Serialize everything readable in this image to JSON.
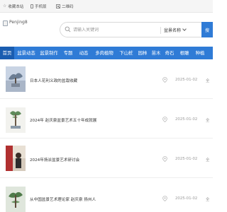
{
  "topbar": {
    "bookmark": "收藏本站",
    "mobile": "手机版",
    "qrcode": "二维码"
  },
  "header": {
    "logo_alt": "Penjing8"
  },
  "search": {
    "placeholder": "请输入关键词",
    "category": "盆景名称",
    "button_label": "搜"
  },
  "nav": {
    "items": [
      {
        "label": "首页",
        "active": true
      },
      {
        "label": "盆景动态"
      },
      {
        "label": "盆景制作"
      },
      {
        "label": "专题"
      },
      {
        "label": "动态"
      },
      {
        "label": "多肉植物"
      },
      {
        "label": "下山桩"
      },
      {
        "label": "园林"
      },
      {
        "label": "苗木"
      },
      {
        "label": "奇石"
      },
      {
        "label": "根雕"
      },
      {
        "label": "种植"
      }
    ]
  },
  "list": {
    "items": [
      {
        "title": "日本人花利义政的盆栽收藏",
        "date": "2025-01-02",
        "more": "全"
      },
      {
        "title": "2024年 赵庆泉盆景艺术五十年成就展",
        "date": "2025-01-02",
        "more": "全"
      },
      {
        "title": "2024年扬派盆景艺术研讨会",
        "date": "2025-01-02",
        "more": "全"
      },
      {
        "title": "从中国盆景艺术理论家 赵庆泉 扬州人",
        "date": "2025-01-02",
        "more": "全"
      }
    ]
  },
  "colors": {
    "accent": "#2f7bd6",
    "nav_active": "#1a5db0",
    "date_text": "#999999"
  },
  "icons": {
    "bookmark": "star-icon",
    "mobile": "phone-icon",
    "qrcode": "qrcode-icon",
    "search": "search-icon",
    "row": "location-icon"
  }
}
